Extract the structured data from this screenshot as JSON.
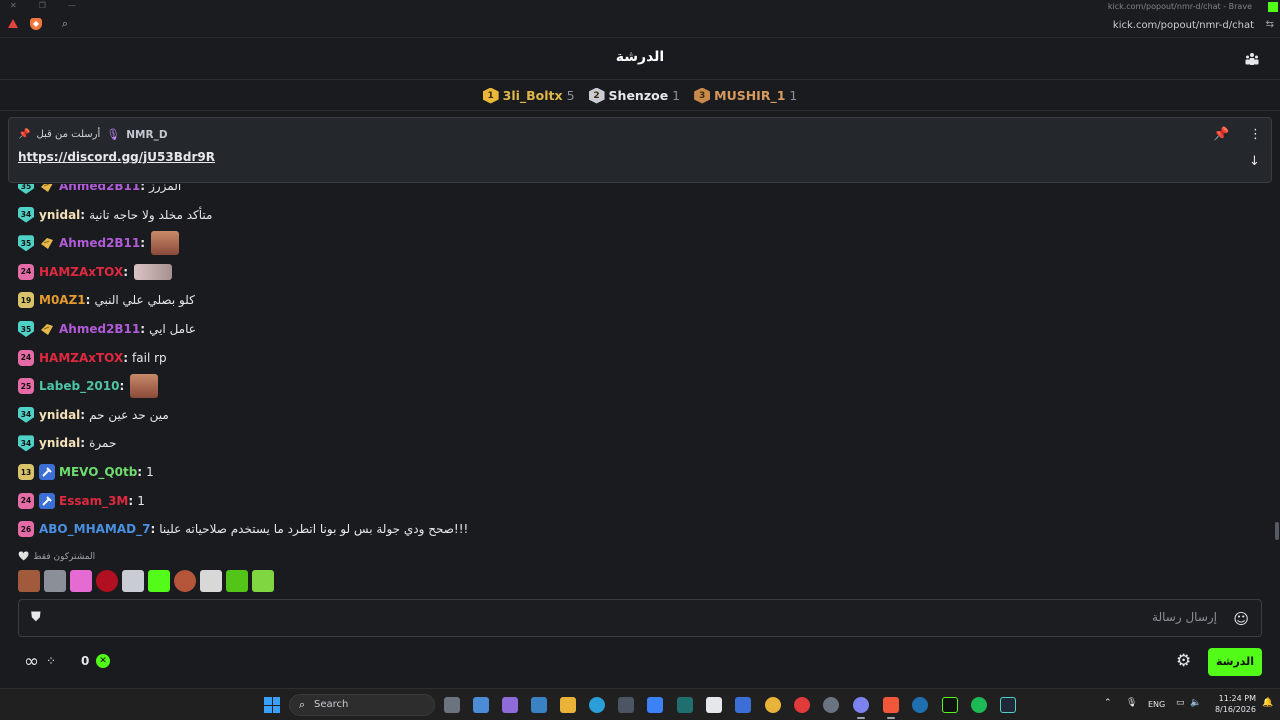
{
  "browser": {
    "window_title": "kick.com/popout/nmr-d/chat - Brave",
    "url": "kick.com/popout/nmr-d/chat"
  },
  "chat": {
    "title": "الدرشة",
    "leaderboard": [
      {
        "rank": "1",
        "name": "3li_Boltx",
        "count": "5",
        "color": "#e0b84a",
        "badge_color": "#e9b83a"
      },
      {
        "rank": "2",
        "name": "Shenzoe",
        "count": "1",
        "color": "#e5e7eb",
        "badge_color": "#c9ccd2"
      },
      {
        "rank": "3",
        "name": "MUSHIR_1",
        "count": "1",
        "color": "#d79a5c",
        "badge_color": "#c9894c"
      }
    ],
    "pinned": {
      "pinned_label": "أرسلت من قبل",
      "author": "NMR_D",
      "link": "https://discord.gg/jU53Bdr9R"
    },
    "messages": [
      {
        "badge": "35",
        "badge_color": "#4fd1c5",
        "role_icon": "gift-icon",
        "username": "Ahmed2B11",
        "color": "#b15bd9",
        "text": "المزرز",
        "emote": "",
        "partial": true
      },
      {
        "badge": "34",
        "badge_color": "#4fd1c5",
        "role_icon": "",
        "username": "ynidal",
        "color": "#f5e1b8",
        "text": "متأكد مخلد ولا حاجه تانية",
        "emote": ""
      },
      {
        "badge": "35",
        "badge_color": "#4fd1c5",
        "role_icon": "gift-icon",
        "username": "Ahmed2B11",
        "color": "#b15bd9",
        "text": "",
        "emote": "face"
      },
      {
        "badge": "24",
        "badge_color": "#e46ba6",
        "role_icon": "",
        "username": "HAMZAxTOX",
        "color": "#e0283f",
        "text": "",
        "emote": "wide"
      },
      {
        "badge": "19",
        "badge_color": "#d9c36a",
        "role_icon": "",
        "username": "M0AZ1",
        "color": "#e59a2f",
        "text": "كلو بصلي علي النبي",
        "emote": ""
      },
      {
        "badge": "35",
        "badge_color": "#4fd1c5",
        "role_icon": "gift-icon",
        "username": "Ahmed2B11",
        "color": "#b15bd9",
        "text": "عامل ايي",
        "emote": ""
      },
      {
        "badge": "24",
        "badge_color": "#e46ba6",
        "role_icon": "",
        "username": "HAMZAxTOX",
        "color": "#e0283f",
        "text": "fail rp",
        "emote": ""
      },
      {
        "badge": "25",
        "badge_color": "#e46ba6",
        "role_icon": "",
        "username": "Labeb_2010",
        "color": "#4fc3a6",
        "text": "",
        "emote": "face"
      },
      {
        "badge": "34",
        "badge_color": "#4fd1c5",
        "role_icon": "",
        "username": "ynidal",
        "color": "#f5e1b8",
        "text": "مين حد عين حم",
        "emote": ""
      },
      {
        "badge": "34",
        "badge_color": "#4fd1c5",
        "role_icon": "",
        "username": "ynidal",
        "color": "#f5e1b8",
        "text": "حمرة",
        "emote": ""
      },
      {
        "badge": "13",
        "badge_color": "#d9c36a",
        "role_icon": "hammer-icon",
        "username": "MEVO_Q0tb",
        "color": "#6fdc6f",
        "text": "1",
        "emote": ""
      },
      {
        "badge": "24",
        "badge_color": "#e46ba6",
        "role_icon": "hammer-icon",
        "username": "Essam_3M",
        "color": "#e0283f",
        "text": "1",
        "emote": ""
      },
      {
        "badge": "26",
        "badge_color": "#e46ba6",
        "role_icon": "",
        "username": "ABO_MHAMAD_7",
        "color": "#4a90e2",
        "text": "صحح ودي جولة بس لو بونا اتطرد ما يستخدم صلاحياته علينا!!!",
        "emote": ""
      }
    ],
    "subs_only_label": "المشتركون فقط",
    "emote_row_colors": [
      "#a15a3c",
      "#8a8f98",
      "#e56bd2",
      "#b01020",
      "#c9ccd2",
      "#53fc18",
      "#b5553a",
      "#d8d8d8",
      "#53c418",
      "#7fd640"
    ],
    "input_placeholder": "إرسال رسالة",
    "points": "0",
    "send_button": "الدرشة"
  },
  "taskbar": {
    "search_placeholder": "Search",
    "lang": "ENG",
    "time": "11:24 PM",
    "date": "8/16/2026"
  }
}
